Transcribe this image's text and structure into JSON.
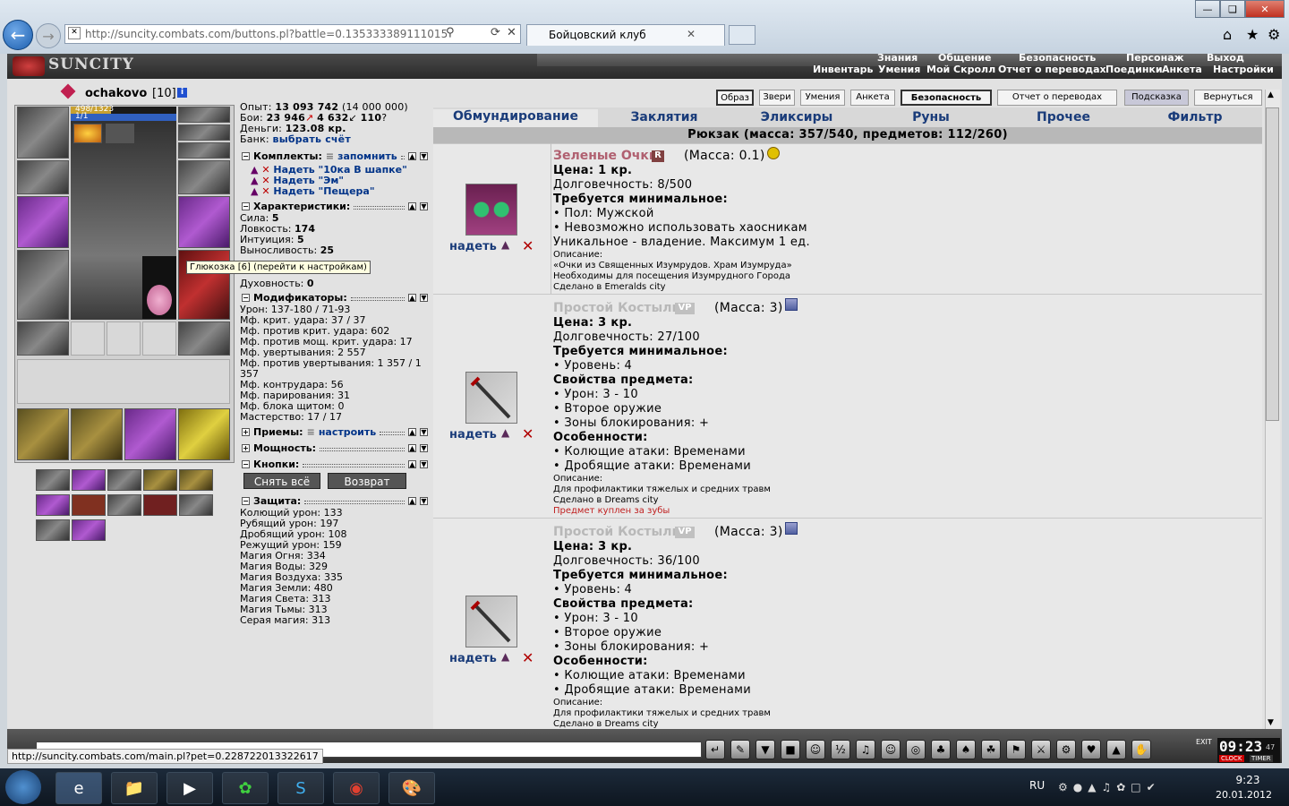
{
  "browser": {
    "address": "http://suncity.combats.com/buttons.pl?battle=0.135333389111015",
    "tab_title": "Бойцовский клуб",
    "status_url": "http://suncity.combats.com/main.pl?pet=0.228722013322617"
  },
  "game": {
    "logo": "SUNCITY",
    "top_menu": [
      "Знания",
      "Общение",
      "Безопасность",
      "Персонаж",
      "Выход"
    ],
    "sub_menu": [
      "Инвентарь",
      "Умения",
      "Мой Скролл",
      "Отчет о переводах",
      "Поединки",
      "Анкета",
      "Настройки"
    ]
  },
  "character": {
    "name": "ochakovo",
    "level": "[10]",
    "hp": "498/1323",
    "mp": "1/1",
    "tooltip": "Глюкозка [6] (перейти к настройкам)"
  },
  "stats": {
    "exp_label": "Опыт:",
    "exp": "13 093 742",
    "exp_next": "(14 000 000)",
    "fights_label": "Бои:",
    "wins": "23 946",
    "losses": "4 632",
    "draws": "110",
    "money_label": "Деньги:",
    "money": "123.08 кр.",
    "bank_label": "Банк:",
    "bank_link": "выбрать счёт"
  },
  "sets": {
    "title": "Комплекты:",
    "remember": "запомнить",
    "items": [
      "Надеть \"10ка В шапке\"",
      "Надеть \"Эм\"",
      "Надеть \"Пещера\""
    ]
  },
  "characteristics": {
    "title": "Характеристики:",
    "items": [
      {
        "label": "Сила:",
        "value": "5"
      },
      {
        "label": "Ловкость:",
        "value": "174"
      },
      {
        "label": "Интуиция:",
        "value": "5"
      },
      {
        "label": "Выносливость:",
        "value": "25"
      }
    ],
    "spirit_label": "Духовность:",
    "spirit": "0"
  },
  "modifiers": {
    "title": "Модификаторы:",
    "lines": [
      "Урон: 137-180 / 71-93",
      "Мф. крит. удара: 37 / 37",
      "Мф. против крит. удара: 602",
      "Мф. против мощ. крит. удара: 17",
      "Мф. увертывания: 2 557",
      "Мф. против увертывания: 1 357 / 1",
      "357",
      "Мф. контрудара: 56",
      "Мф. парирования: 31",
      "Мф. блока щитом: 0",
      "Мастерство: 17 / 17"
    ]
  },
  "techniques": {
    "title": "Приемы:",
    "link": "настроить"
  },
  "powers": {
    "title": "Мощность:"
  },
  "buttons_section": {
    "title": "Кнопки:",
    "remove_all": "Снять всё",
    "return": "Возврат"
  },
  "defense": {
    "title": "Защита:",
    "lines": [
      "Колющий урон: 133",
      "Рубящий урон: 197",
      "Дробящий урон: 108",
      "Режущий урон: 159",
      "Магия Огня: 334",
      "Магия Воды: 329",
      "Магия Воздуха: 335",
      "Магия Земли: 480",
      "Магия Света: 313",
      "Магия Тьмы: 313",
      "Серая магия: 313"
    ]
  },
  "right_top_buttons": [
    "Образ",
    "Звери",
    "Умения",
    "Анкета",
    "Безопасность",
    "Отчет о переводах",
    "Подсказка",
    "Вернуться"
  ],
  "inventory_tabs": [
    "Обмундирование",
    "Заклятия",
    "Эликсиры",
    "Руны",
    "Прочее",
    "Фильтр"
  ],
  "backpack_header": "Рюкзак (масса: 357/540, предметов: 112/260)",
  "wear_label": "надеть",
  "items": [
    {
      "name": "Зеленые Очки",
      "badge": "R",
      "mass": "(Масса: 0.1)",
      "price": "Цена: 1 кр.",
      "durability": "Долговечность: 8/500",
      "req_title": "Требуется минимальное:",
      "lines": [
        "• Пол: Мужской",
        "• Невозможно использовать хаосникам",
        "Уникальное - владение. Максимум 1 ед."
      ],
      "small": [
        "Описание:",
        "«Очки из Священных Изумрудов. Храм Изумруда»",
        "Необходимы для посещения Изумрудного Города",
        "Сделано в Emeralds city"
      ],
      "red_note": ""
    },
    {
      "name": "Простой Костыль",
      "badge": "VP",
      "mass": "(Масса: 3)",
      "price": "Цена: 3 кр.",
      "durability": "Долговечность: 27/100",
      "req_title": "Требуется минимальное:",
      "lines": [
        "• Уровень: 4",
        "Свойства предмета:",
        "• Урон: 3 - 10",
        "• Второе оружие",
        "• Зоны блокирования: +",
        "Особенности:",
        "• Колющие атаки: Временами",
        "• Дробящие атаки: Временами"
      ],
      "small": [
        "Описание:",
        "Для профилактики тяжелых и средних травм",
        "Сделано в Dreams city"
      ],
      "red_note": "Предмет куплен за зубы"
    },
    {
      "name": "Простой Костыль",
      "badge": "VP",
      "mass": "(Масса: 3)",
      "price": "Цена: 3 кр.",
      "durability": "Долговечность: 36/100",
      "req_title": "Требуется минимальное:",
      "lines": [
        "• Уровень: 4",
        "Свойства предмета:",
        "• Урон: 3 - 10",
        "• Второе оружие",
        "• Зоны блокирования: +",
        "Особенности:",
        "• Колющие атаки: Временами",
        "• Дробящие атаки: Временами"
      ],
      "small": [
        "Описание:",
        "Для профилактики тяжелых и средних травм",
        "Сделано в Dreams city"
      ],
      "red_note": ""
    }
  ],
  "clock": {
    "time": "09:23",
    "seconds": "47",
    "label1": "CLOCK",
    "label2": "TIMER",
    "exit": "EXIT"
  },
  "taskbar": {
    "lang": "RU",
    "time": "9:23",
    "date": "20.01.2012"
  }
}
